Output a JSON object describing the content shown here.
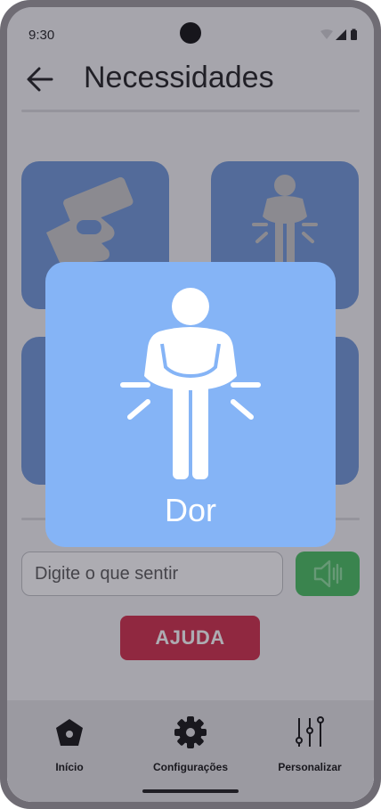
{
  "status_bar": {
    "time": "9:30"
  },
  "app_bar": {
    "title": "Necessidades"
  },
  "tiles": [
    {
      "icon": "hand-giving-money-icon"
    },
    {
      "icon": "person-in-pain-icon"
    },
    {
      "icon": "tile-icon"
    },
    {
      "icon": "tile-icon"
    }
  ],
  "input": {
    "placeholder": "Digite o que sentir",
    "value": ""
  },
  "speak_button": {
    "icon": "speaker-icon"
  },
  "help_button": {
    "label": "AJUDA"
  },
  "bottom_nav": {
    "items": [
      {
        "label": "Início",
        "icon": "home-icon"
      },
      {
        "label": "Configurações",
        "icon": "gear-icon"
      },
      {
        "label": "Personalizar",
        "icon": "sliders-icon"
      }
    ]
  },
  "popup": {
    "label": "Dor",
    "icon": "person-in-pain-icon"
  },
  "colors": {
    "tile": "#6e97d8",
    "popup": "#85b4f6",
    "speak": "#46bf5e",
    "help": "#d12b48"
  }
}
